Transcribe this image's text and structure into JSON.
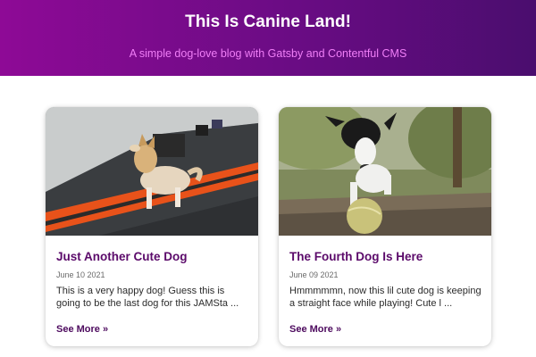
{
  "header": {
    "title": "This Is Canine Land!",
    "subtitle": "A simple dog-love blog with Gatsby and Contentful CMS"
  },
  "posts": [
    {
      "title": "Just Another Cute Dog",
      "date": "June 10 2021",
      "excerpt": "This is a very happy dog! Guess this is going to be the last dog for this JAMSta ...",
      "more_label": "See More »"
    },
    {
      "title": "The Fourth Dog Is Here",
      "date": "June 09 2021",
      "excerpt": "Hmmmmmn, now this lil cute dog is keeping a straight face while playing! Cute l ...",
      "more_label": "See More »"
    }
  ],
  "colors": {
    "header_gradient_start": "#8e0a96",
    "header_gradient_end": "#4a0d6e",
    "subtitle": "#f07ef7",
    "post_title": "#5b0a6a"
  }
}
